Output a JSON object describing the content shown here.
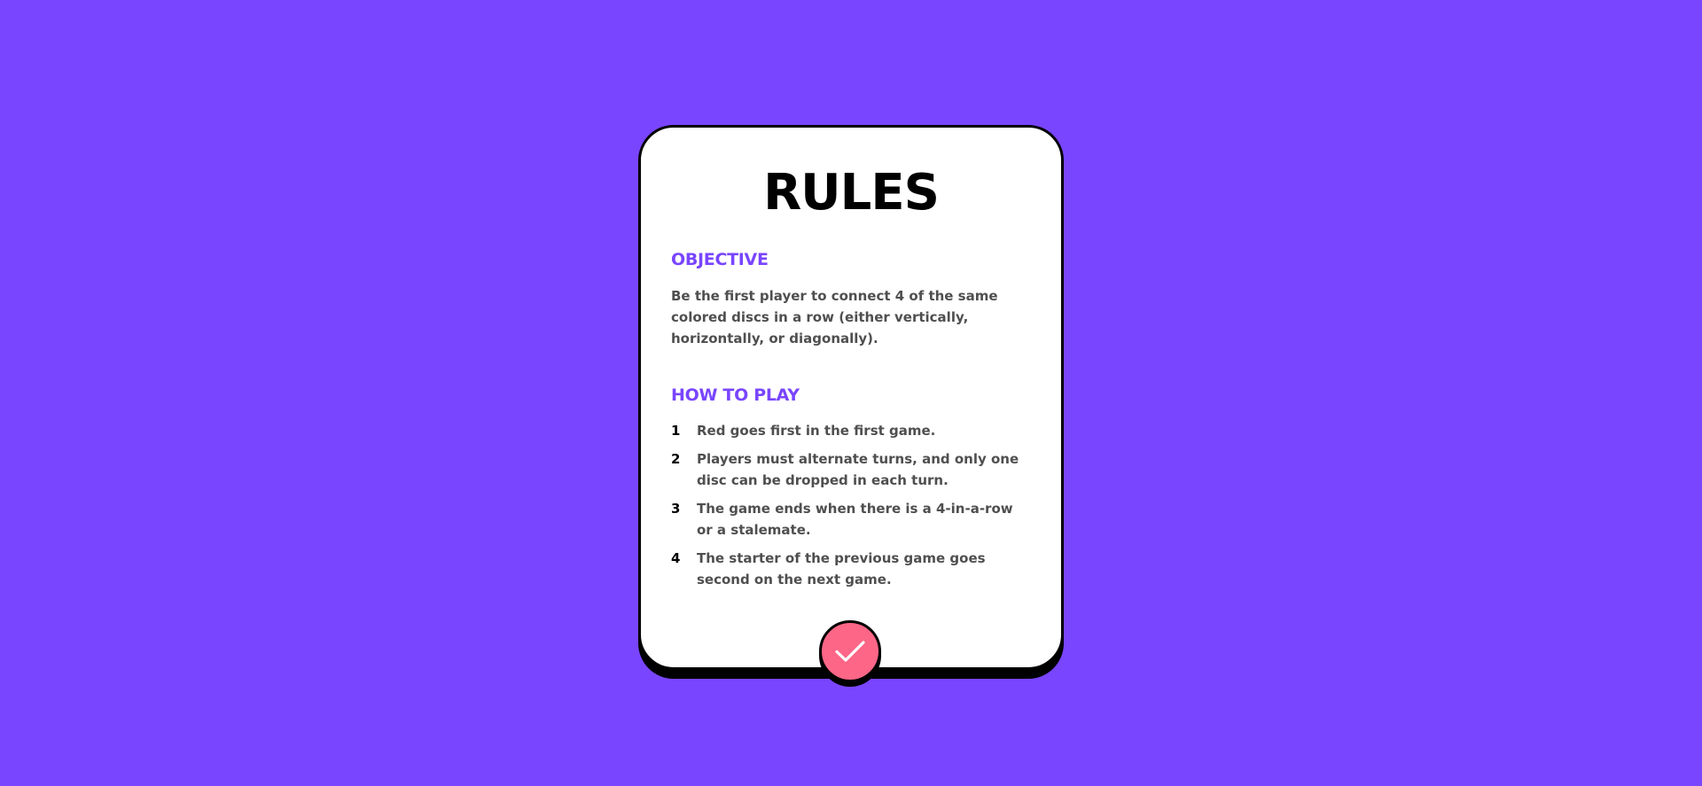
{
  "rules": {
    "title": "RULES",
    "objective": {
      "heading": "OBJECTIVE",
      "text": "Be the first player to connect 4 of the same colored discs in a row (either vertically, horizontally, or diagonally)."
    },
    "how_to_play": {
      "heading": "HOW TO PLAY",
      "steps": [
        {
          "number": "1",
          "text": "Red goes first in the first game."
        },
        {
          "number": "2",
          "text": "Players must alternate turns, and only one disc can be dropped in each turn."
        },
        {
          "number": "3",
          "text": "The game ends when there is a 4-in-a-row or a stalemate."
        },
        {
          "number": "4",
          "text": "The starter of the previous game goes second on the next game."
        }
      ]
    }
  },
  "confirm_button": {
    "icon": "check-icon"
  },
  "colors": {
    "background": "#7945ff",
    "accent": "#7945ff",
    "button": "#fd6687",
    "card": "#ffffff",
    "border": "#000000"
  }
}
